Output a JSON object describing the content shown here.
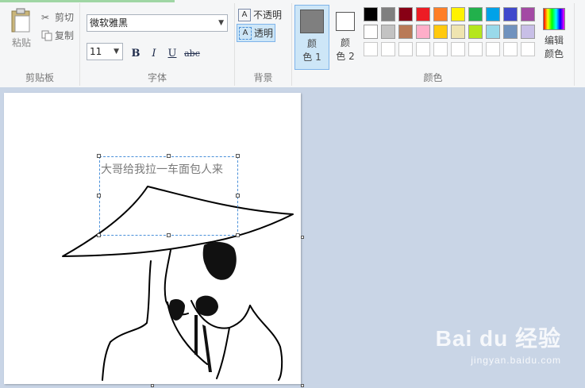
{
  "clipboard": {
    "paste_label": "粘贴",
    "cut_label": "剪切",
    "copy_label": "复制",
    "group_label": "剪贴板"
  },
  "font": {
    "family_value": "微软雅黑",
    "size_value": "11",
    "bold_label": "B",
    "italic_label": "I",
    "underline_label": "U",
    "strike_label": "abc",
    "group_label": "字体"
  },
  "background": {
    "opaque_label": "不透明",
    "transparent_label": "透明",
    "group_label": "背景"
  },
  "colors": {
    "color1_label_line1": "颜",
    "color1_label_line2": "色 1",
    "color2_label_line1": "颜",
    "color2_label_line2": "色 2",
    "edit_label_line1": "编辑",
    "edit_label_line2": "颜色",
    "group_label": "颜色",
    "color1_value": "#7f7f7f",
    "color2_value": "#ffffff",
    "palette_row1": [
      "#000000",
      "#7f7f7f",
      "#880015",
      "#ed1c24",
      "#ff7f27",
      "#fff200",
      "#22b14c",
      "#00a2e8",
      "#3f48cc",
      "#a349a4"
    ],
    "palette_row2": [
      "#ffffff",
      "#c3c3c3",
      "#b97a57",
      "#ffaec9",
      "#ffc90e",
      "#efe4b0",
      "#b5e61d",
      "#99d9ea",
      "#7092be",
      "#c8bfe7"
    ],
    "palette_row3": [
      "#ffffff",
      "#ffffff",
      "#ffffff",
      "#ffffff",
      "#ffffff",
      "#ffffff",
      "#ffffff",
      "#ffffff",
      "#ffffff",
      "#ffffff"
    ]
  },
  "canvas": {
    "text_content": "大哥给我拉一车面包人来"
  },
  "watermark": {
    "main": "Bai du 经验",
    "sub": "jingyan.baidu.com"
  }
}
